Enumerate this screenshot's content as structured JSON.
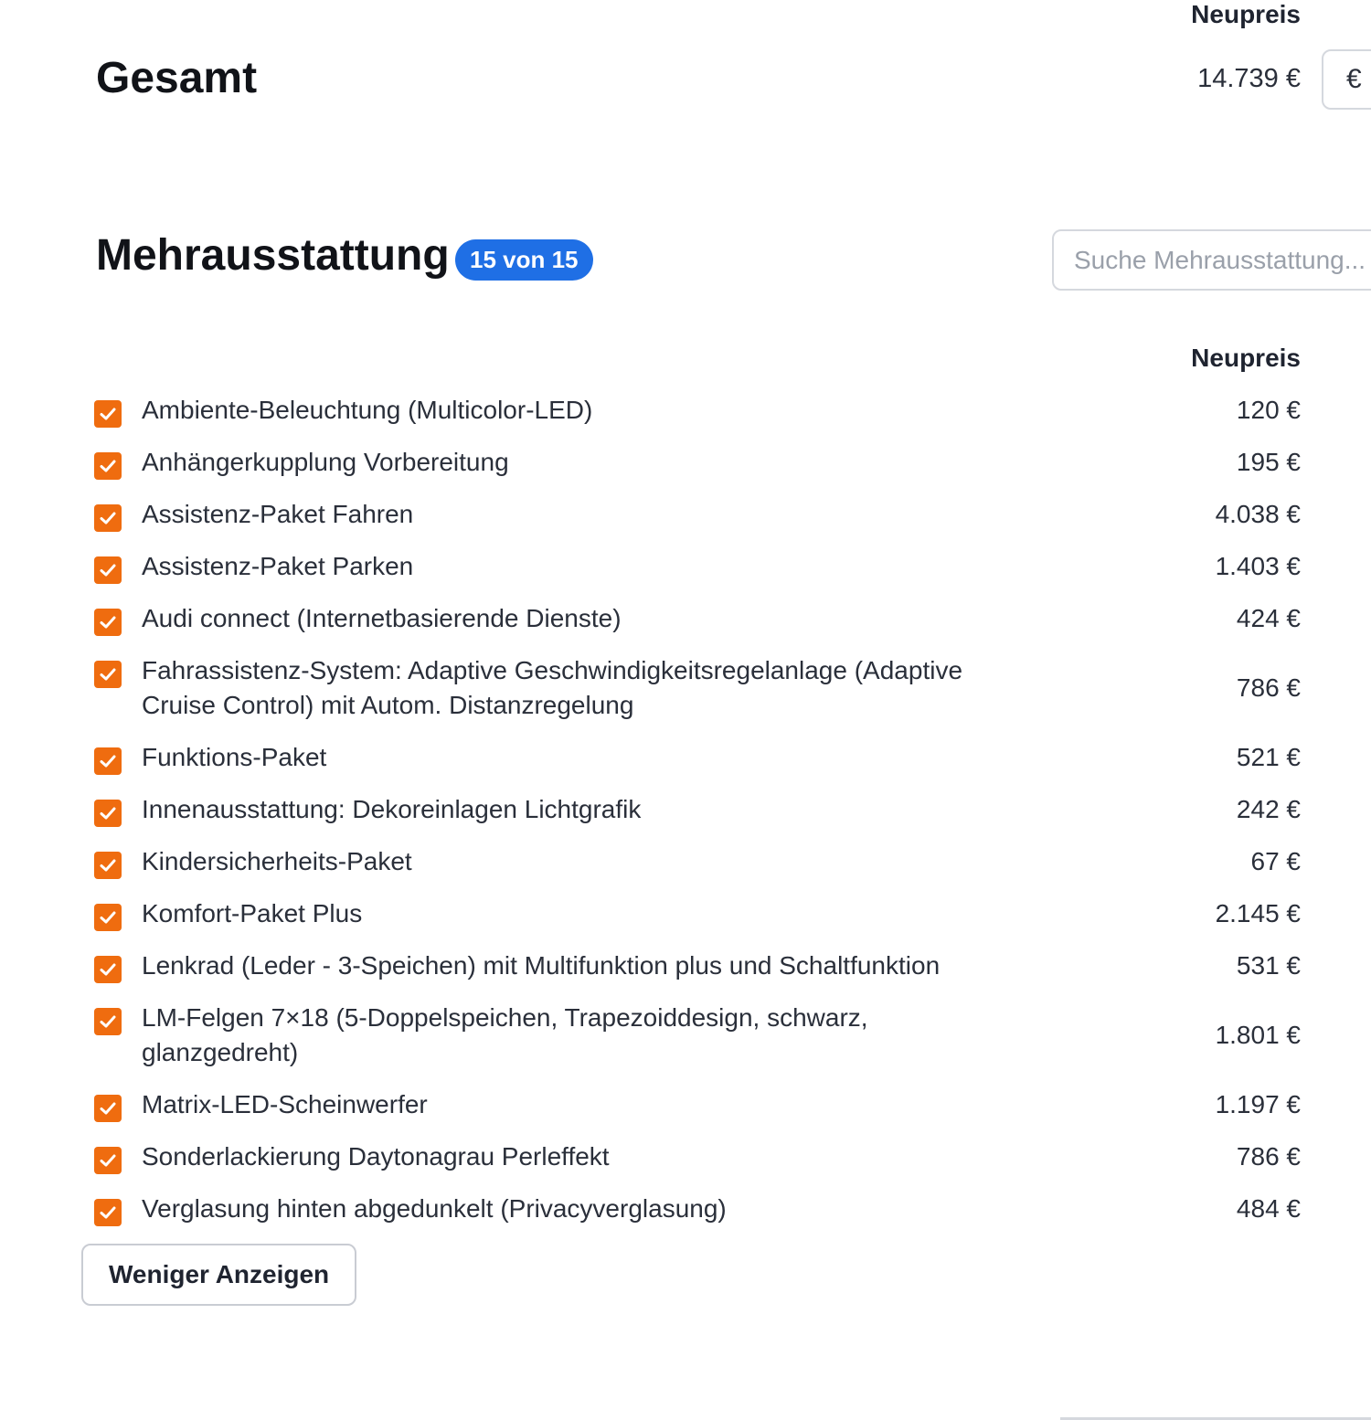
{
  "summary": {
    "column_header": "Neupreis",
    "title": "Gesamt",
    "total_price": "14.739 €",
    "currency_value": "€"
  },
  "equipment": {
    "title": "Mehrausstattung",
    "count_badge": "15 von 15",
    "search_placeholder": "Suche Mehrausstattung...",
    "column_header": "Neupreis",
    "items": [
      {
        "label": "Ambiente-Beleuchtung (Multicolor-LED)",
        "price": "120 €",
        "checked": true
      },
      {
        "label": "Anhängerkupplung Vorbereitung",
        "price": "195 €",
        "checked": true
      },
      {
        "label": "Assistenz-Paket Fahren",
        "price": "4.038 €",
        "checked": true
      },
      {
        "label": "Assistenz-Paket Parken",
        "price": "1.403 €",
        "checked": true
      },
      {
        "label": "Audi connect (Internetbasierende Dienste)",
        "price": "424 €",
        "checked": true
      },
      {
        "label": "Fahrassistenz-System: Adaptive Geschwindigkeitsregelanlage (Adaptive Cruise Control) mit Autom. Distanzregelung",
        "price": "786 €",
        "checked": true
      },
      {
        "label": "Funktions-Paket",
        "price": "521 €",
        "checked": true
      },
      {
        "label": "Innenausstattung: Dekoreinlagen Lichtgrafik",
        "price": "242 €",
        "checked": true
      },
      {
        "label": "Kindersicherheits-Paket",
        "price": "67 €",
        "checked": true
      },
      {
        "label": "Komfort-Paket Plus",
        "price": "2.145 €",
        "checked": true
      },
      {
        "label": "Lenkrad (Leder - 3-Speichen) mit Multifunktion plus und Schaltfunktion",
        "price": "531 €",
        "checked": true
      },
      {
        "label": "LM-Felgen 7×18 (5-Doppelspeichen, Trapezoiddesign, schwarz, glanzgedreht)",
        "price": "1.801 €",
        "checked": true
      },
      {
        "label": "Matrix-LED-Scheinwerfer",
        "price": "1.197 €",
        "checked": true
      },
      {
        "label": "Sonderlackierung Daytonagrau Perleffekt",
        "price": "786 €",
        "checked": true
      },
      {
        "label": "Verglasung hinten abgedunkelt (Privacyverglasung)",
        "price": "484 €",
        "checked": true
      }
    ],
    "less_button_label": "Weniger Anzeigen"
  },
  "colors": {
    "accent_orange": "#ef6c0f",
    "badge_blue": "#1f6fe5"
  },
  "icons": {
    "checkbox": "checkmark-icon"
  }
}
